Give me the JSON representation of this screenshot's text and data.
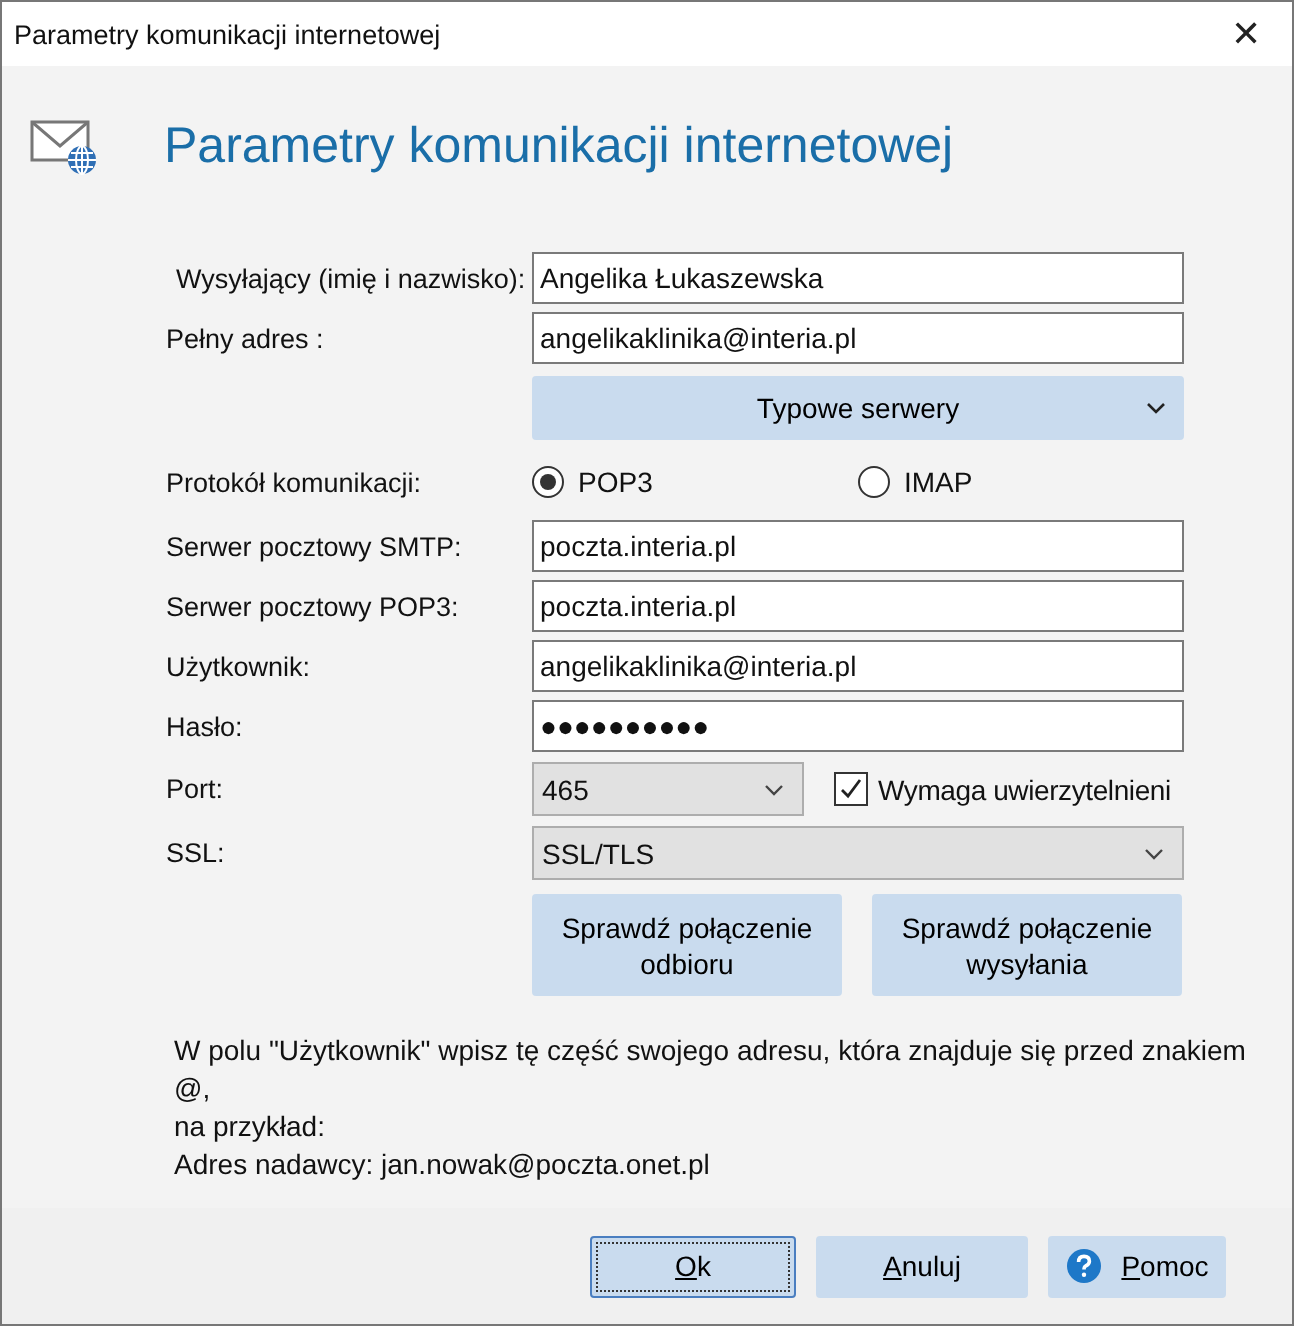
{
  "window": {
    "title": "Parametry komunikacji internetowej",
    "close": "✕"
  },
  "header": {
    "title": "Parametry komunikacji internetowej"
  },
  "rows": [
    {
      "kind": "text",
      "label": "Wysyłający (imię i nazwisko):",
      "value": "Angelika Łukaszewska"
    },
    {
      "kind": "text",
      "label": "Pełny adres :",
      "value": "angelikaklinika@interia.pl"
    },
    {
      "kind": "dropbutton",
      "label": "Typowe serwery"
    },
    {
      "kind": "radio",
      "label": "Protokół komunikacji:",
      "options": [
        {
          "label": "POP3",
          "selected": true
        },
        {
          "label": "IMAP",
          "selected": false
        }
      ]
    },
    {
      "kind": "text",
      "label": "Serwer pocztowy SMTP:",
      "value": "poczta.interia.pl"
    },
    {
      "kind": "text",
      "label": "Serwer pocztowy POP3:",
      "value": "poczta.interia.pl"
    },
    {
      "kind": "text",
      "label": "Użytkownik:",
      "value": "angelikaklinika@interia.pl"
    },
    {
      "kind": "text",
      "label": "Hasło:",
      "value": "●●●●●●●●●●"
    },
    {
      "kind": "select",
      "label": "Port:",
      "value": "465",
      "check": {
        "label": "Wymaga uwierzytelnieni",
        "checked": true
      }
    },
    {
      "kind": "select",
      "label": "SSL:",
      "value": "SSL/TLS"
    },
    {
      "kind": "buttons",
      "buttons": [
        "Sprawdź połączenie odbioru",
        "Sprawdź połączenie wysyłania"
      ]
    }
  ],
  "help": [
    "W polu \"Użytkownik\" wpisz tę część swojego adresu, która znajduje się przed znakiem @,",
    "na przykład:",
    "Adres nadawcy: jan.nowak@poczta.onet.pl"
  ],
  "footer": [
    {
      "label": "Ok",
      "kind": "default"
    },
    {
      "label": "Anuluj",
      "kind": "plain"
    },
    {
      "label": "Pomoc",
      "kind": "help"
    }
  ]
}
